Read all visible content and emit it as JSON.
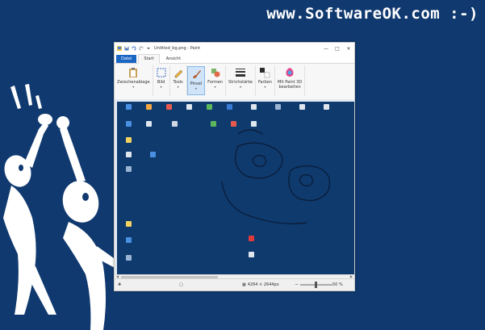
{
  "watermark": "www.SoftwareOK.com :-)",
  "colors": {
    "background": "#10396f",
    "canvas": "#0f3a6e",
    "file_tab": "#1a66c4",
    "ribbon_selected": "#cfe4f8"
  },
  "window": {
    "title": "Untitled_bg.png - Paint",
    "quick_access_icons": [
      "save-icon",
      "undo-icon",
      "redo-icon",
      "dropdown-icon"
    ]
  },
  "tabs": [
    {
      "label": "Datei",
      "kind": "file"
    },
    {
      "label": "Start",
      "kind": "active"
    },
    {
      "label": "Ansicht",
      "kind": "normal"
    }
  ],
  "ribbon": {
    "clipboard": "Zwischenablage",
    "image": "Bild",
    "tools": "Tools",
    "brushes": "Pinsel",
    "shapes": "Formen",
    "size": "Strichstärke",
    "colors": "Farben",
    "paint3d_line1": "Mit Paint 3D",
    "paint3d_line2": "bearbeiten",
    "arrow": "▾"
  },
  "status": {
    "dimensions": "4264 × 2644px",
    "zoom": "50 %"
  }
}
